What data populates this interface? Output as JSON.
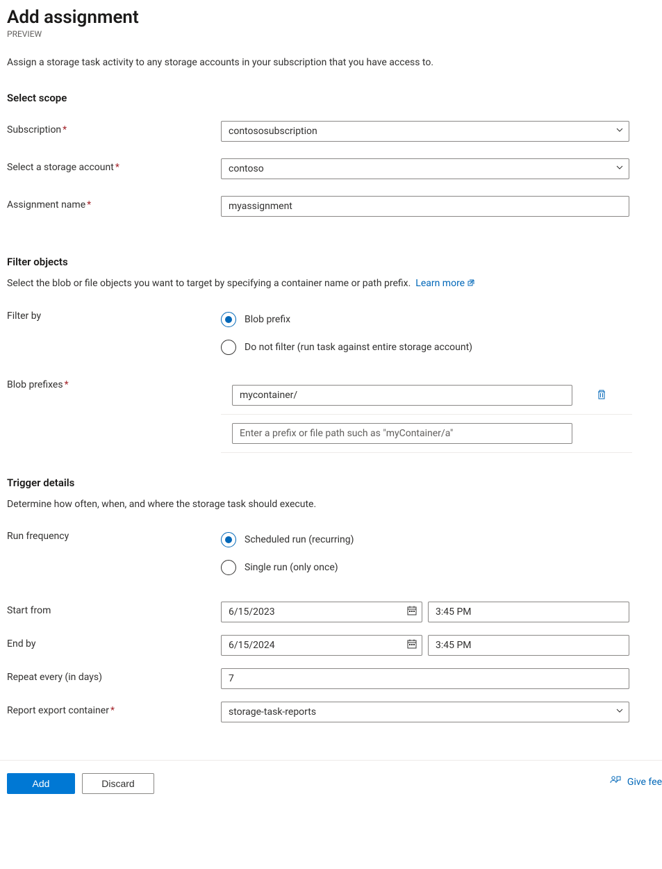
{
  "header": {
    "title": "Add assignment",
    "subtitle": "PREVIEW"
  },
  "intro": "Assign a storage task activity to any storage accounts in your subscription that you have access to.",
  "scope": {
    "title": "Select scope",
    "subscription_label": "Subscription",
    "subscription_value": "contososubscription",
    "storage_label": "Select a storage account",
    "storage_value": "contoso",
    "assignment_label": "Assignment name",
    "assignment_value": "myassignment"
  },
  "filter": {
    "title": "Filter objects",
    "desc": "Select the blob or file objects you want to target by specifying a container name or path prefix.",
    "learn_more": "Learn more",
    "filter_by_label": "Filter by",
    "radio_blob_prefix": "Blob prefix",
    "radio_no_filter": "Do not filter (run task against entire storage account)",
    "filter_by_selected": "blob_prefix",
    "prefixes_label": "Blob prefixes",
    "prefixes": [
      {
        "value": "mycontainer/",
        "placeholder": ""
      }
    ],
    "new_prefix_placeholder": "Enter a prefix or file path such as \"myContainer/a\""
  },
  "trigger": {
    "title": "Trigger details",
    "desc": "Determine how often, when, and where the storage task should execute.",
    "freq_label": "Run frequency",
    "radio_scheduled": "Scheduled run (recurring)",
    "radio_single": "Single run (only once)",
    "freq_selected": "scheduled",
    "start_label": "Start from",
    "start_date": "6/15/2023",
    "start_time": "3:45 PM",
    "end_label": "End by",
    "end_date": "6/15/2024",
    "end_time": "3:45 PM",
    "repeat_label": "Repeat every (in days)",
    "repeat_value": "7",
    "export_label": "Report export container",
    "export_value": "storage-task-reports"
  },
  "footer": {
    "add": "Add",
    "discard": "Discard",
    "feedback": "Give fee"
  }
}
